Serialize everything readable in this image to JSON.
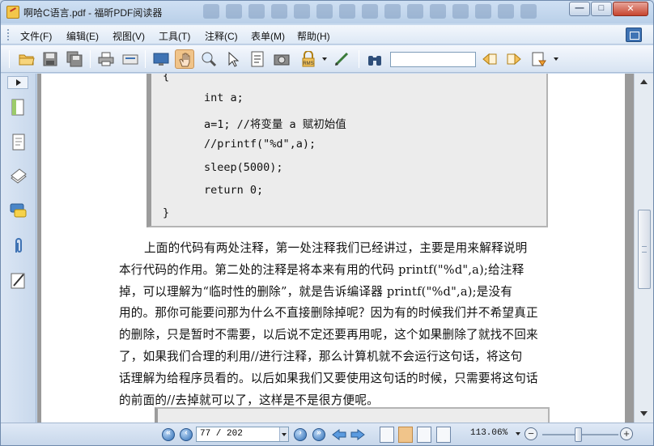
{
  "window": {
    "title": "啊哈C语言.pdf - 福昕PDF阅读器",
    "buttons": {
      "minimize": "—",
      "maximize": "□",
      "close": "✕"
    }
  },
  "menu": [
    {
      "label": "文件(F)"
    },
    {
      "label": "编辑(E)"
    },
    {
      "label": "视图(V)"
    },
    {
      "label": "工具(T)"
    },
    {
      "label": "注释(C)"
    },
    {
      "label": "表单(M)"
    },
    {
      "label": "帮助(H)"
    }
  ],
  "toolbar": {
    "icons": [
      "open-folder-icon",
      "save-icon",
      "save-all-icon",
      "print-icon",
      "scan-icon",
      "fullscreen-icon",
      "hand-tool-icon",
      "zoom-tool-icon",
      "select-cursor-icon",
      "text-select-icon",
      "snapshot-icon",
      "rms-lock-icon",
      "sign-icon",
      "binoculars-icon",
      "find-prev-icon",
      "find-next-icon",
      "highlight-icon"
    ],
    "active_tool": "hand-tool-icon",
    "find": {
      "value": ""
    },
    "rms_label": "RMS"
  },
  "document": {
    "code_lines": [
      "{",
      "int a;",
      "a=1; //将变量 a 赋初始值",
      "//printf(\"%d\",a);",
      "sleep(5000);",
      "return 0;",
      "}"
    ],
    "paragraph_lines": [
      "上面的代码有两处注释，第一处注释我们已经讲过，主要是用来解释说明",
      "本行代码的作用。第二处的注释是将本来有用的代码 printf(\"%d\",a);给注释",
      "掉，可以理解为“临时性的删除”，就是告诉编译器 printf(\"%d\",a);是没有",
      "用的。那你可能要问那为什么不直接删除掉呢？因为有的时候我们并不希望真正",
      "的删除，只是暂时不需要，以后说不定还要再用呢，这个如果删除了就找不回来",
      "了，如果我们合理的利用//进行注释，那么计算机就不会运行这句话，将这句",
      "话理解为给程序员看的。以后如果我们又要使用这句话的时候，只需要将这句话",
      "的前面的//去掉就可以了，这样是不是很方便呢。"
    ]
  },
  "statusbar": {
    "page_indicator": "77 / 202",
    "zoom": "113.06%",
    "zoom_level": 0.6
  },
  "colors": {
    "accent": "#3f73b4",
    "active_tool": "#f0c48a",
    "code_bg": "#ececec",
    "title_bg": "#c9daee"
  }
}
